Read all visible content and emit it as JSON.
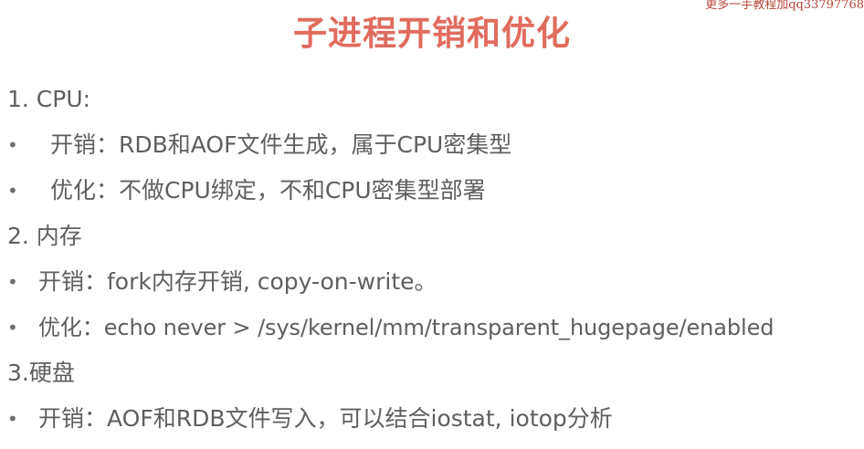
{
  "watermark": "更多一手教程加qq33797768",
  "title": "子进程开销和优化",
  "sections": [
    {
      "heading": "1. CPU:",
      "items": [
        "开销：RDB和AOF文件生成，属于CPU密集型",
        "优化：不做CPU绑定，不和CPU密集型部署"
      ]
    },
    {
      "heading": "2. 内存",
      "items": [
        "开销：fork内存开销, copy-on-write。",
        "优化：echo never > /sys/kernel/mm/transparent_hugepage/enabled"
      ]
    },
    {
      "heading": "3.硬盘",
      "items": [
        "开销：AOF和RDB文件写入，可以结合iostat, iotop分析"
      ]
    }
  ],
  "bullet_glyph": "•"
}
